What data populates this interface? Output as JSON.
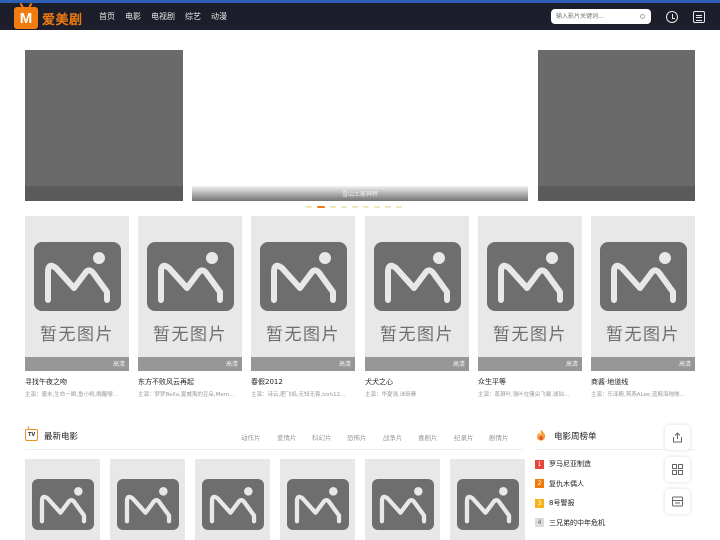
{
  "header": {
    "logo_mark": "M",
    "logo_text": "爱美剧",
    "nav": [
      "首页",
      "电影",
      "电视剧",
      "综艺",
      "动漫"
    ],
    "search_placeholder": "输入影片关键词..."
  },
  "banner": {
    "caption": "雪山土家神秤",
    "dot_count": 9,
    "active_dot": 1
  },
  "placeholder_text": "暂无图片",
  "cards": [
    {
      "title": "寻找午夜之吻",
      "cast": "主演：唐未,生命一瞬,鱼小桃,晚醒嘤...",
      "quality": "高清"
    },
    {
      "title": "东方不败风云再起",
      "cast": "主演：梦梦Bella,夏威夷的豆朵,Mem...",
      "quality": "高清"
    },
    {
      "title": "春假2012",
      "cast": "主演：诗云,肥飞焰,无知无畏,Izsh12...",
      "quality": "高清"
    },
    {
      "title": "犬犬之心",
      "cast": "主演：华夏强,沫砾寨",
      "quality": "高清"
    },
    {
      "title": "众生平等",
      "cast": "主演：蒸涮叶,强叶在骚尖飞聚,琥珀...",
      "quality": "高清"
    },
    {
      "title": "商酱·地道线",
      "cast": "主演：乐泽殿,燕燕ALee,蓝鲸海啪啪...",
      "quality": "高清"
    }
  ],
  "latest": {
    "icon_text": "TV",
    "title": "最新电影",
    "categories": [
      "动作片",
      "爱情片",
      "科幻片",
      "恐怖片",
      "战争片",
      "喜剧片",
      "纪录片",
      "剧情片"
    ],
    "items": 6
  },
  "ranking": {
    "title": "电影周榜单",
    "items": [
      {
        "rank": "1",
        "name": "罗马尼亚制造",
        "color": "#e8453c"
      },
      {
        "rank": "2",
        "name": "复仇木偶人",
        "color": "#f07c10"
      },
      {
        "rank": "3",
        "name": "8号警报",
        "color": "#f5b21a"
      },
      {
        "rank": "4",
        "name": "三兄弟的中年危机",
        "color": "#dddddd"
      }
    ]
  },
  "float_buttons": [
    "share-icon",
    "grid-icon",
    "list-icon"
  ],
  "colors": {
    "header_bg": "#1c1f2b",
    "accent": "#f07c10",
    "placeholder_bg": "#e8e8e8",
    "placeholder_fg": "#6e6e6e"
  }
}
